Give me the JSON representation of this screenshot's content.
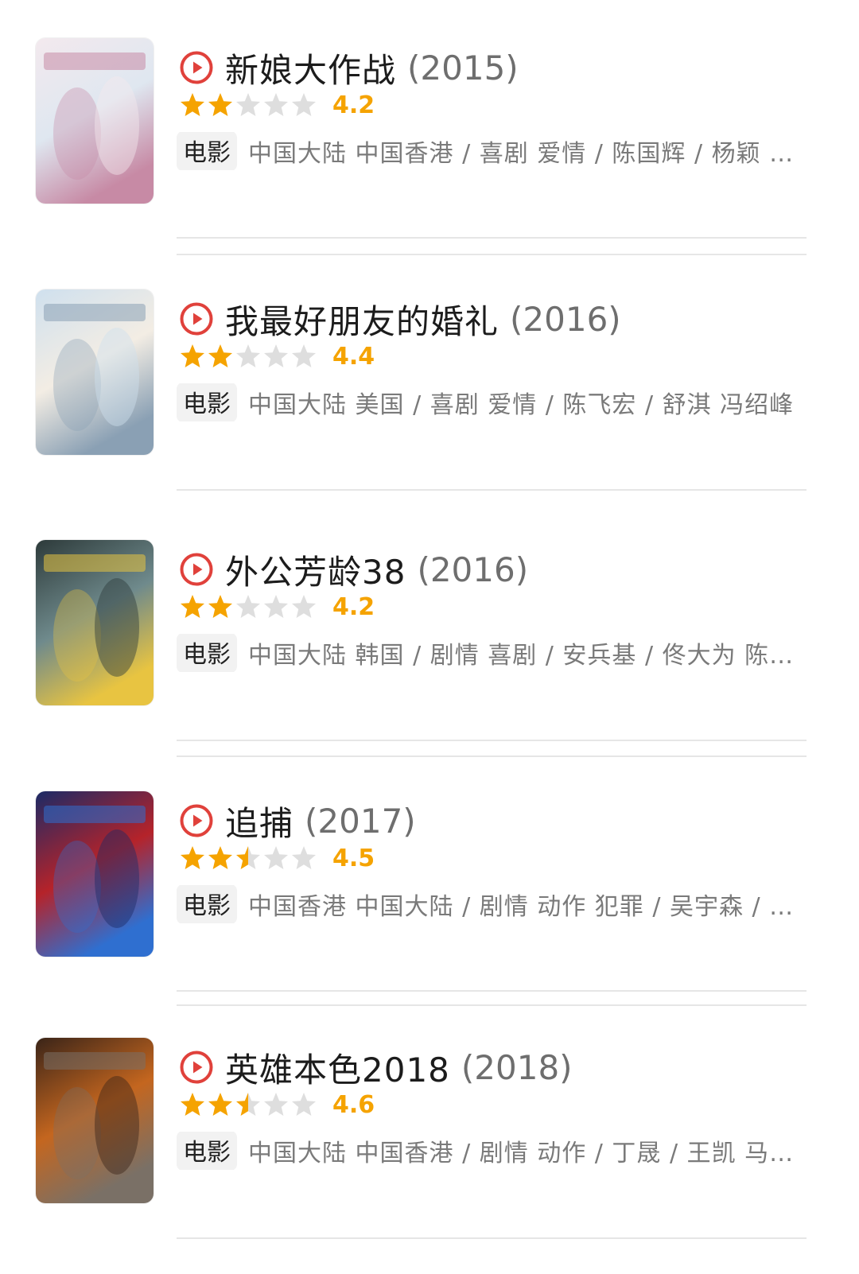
{
  "colors": {
    "accent_red": "#e0413b",
    "star_gold": "#f5a300",
    "star_empty": "#dedede",
    "title_text": "#1c1c1c",
    "meta_text": "#7a7a7a"
  },
  "icons": {
    "play": "play-circle-icon",
    "star": "star-icon"
  },
  "movies": [
    {
      "title": "新娘大作战",
      "year": "(2015)",
      "stars": 2.0,
      "score": "4.2",
      "tag": "电影",
      "meta": "中国大陆 中国香港 / 喜剧 爱情 / 陈国辉 / 杨颖 …",
      "poster_colors": [
        "#f3e9ee",
        "#dfe7f0",
        "#c78aa5"
      ]
    },
    {
      "title": "我最好朋友的婚礼",
      "year": "(2016)",
      "stars": 2.0,
      "score": "4.4",
      "tag": "电影",
      "meta": "中国大陆 美国 / 喜剧 爱情 / 陈飞宏 / 舒淇 冯绍峰",
      "poster_colors": [
        "#cfe0ee",
        "#f3ede4",
        "#8aa0b4"
      ]
    },
    {
      "title": "外公芳龄38",
      "year": "(2016)",
      "stars": 2.0,
      "score": "4.2",
      "tag": "电影",
      "meta": "中国大陆 韩国 / 剧情 喜剧 / 安兵基 / 佟大为 陈…",
      "poster_colors": [
        "#2d3a3a",
        "#6f8a8c",
        "#e8c441"
      ]
    },
    {
      "title": "追捕",
      "year": "(2017)",
      "stars": 2.5,
      "score": "4.5",
      "tag": "电影",
      "meta": "中国香港 中国大陆 / 剧情 动作 犯罪 / 吴宇森 / …",
      "poster_colors": [
        "#1b2a66",
        "#b5232a",
        "#2f6fd0"
      ]
    },
    {
      "title": "英雄本色2018",
      "year": "(2018)",
      "stars": 2.5,
      "score": "4.6",
      "tag": "电影",
      "meta": "中国大陆 中国香港 / 剧情 动作 / 丁晟 / 王凯 马…",
      "poster_colors": [
        "#3a2418",
        "#c4661f",
        "#7a7066"
      ]
    }
  ]
}
